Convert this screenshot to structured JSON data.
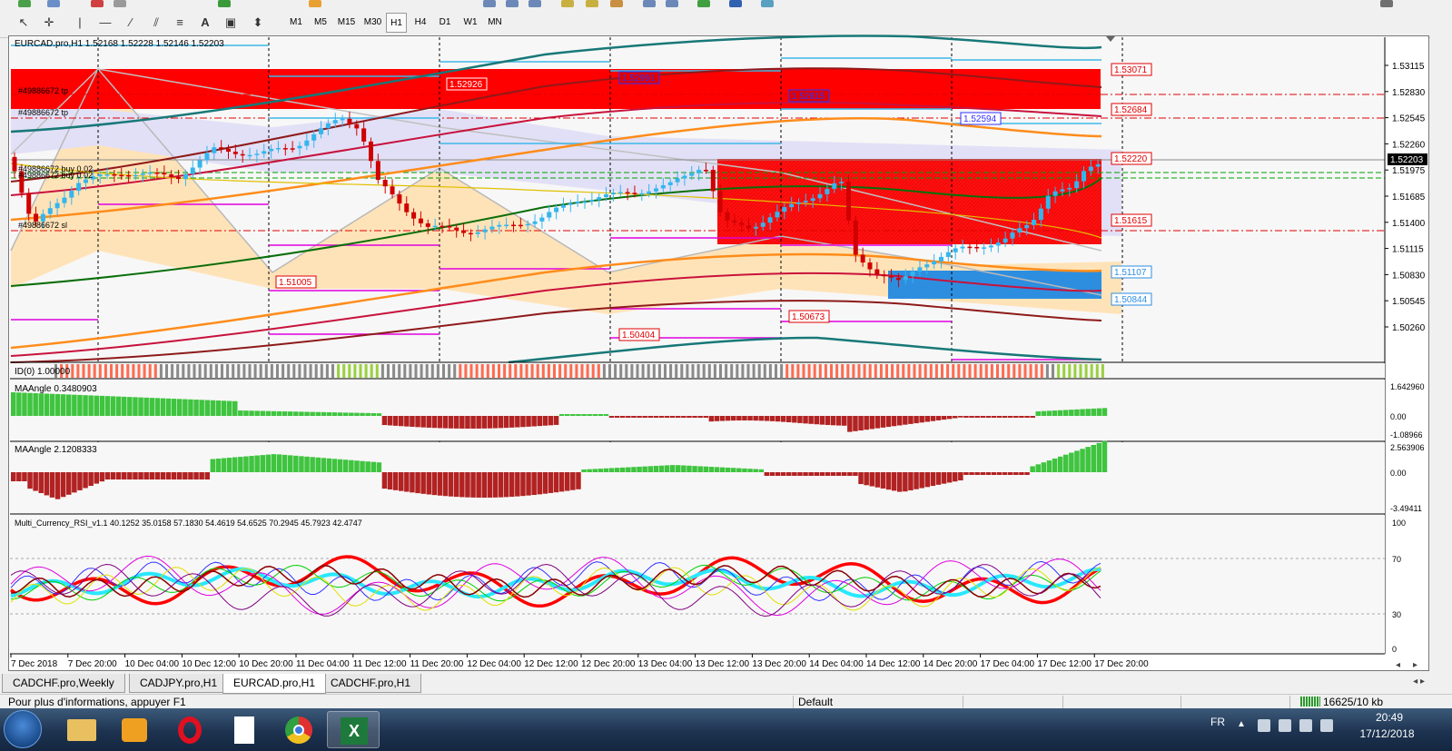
{
  "colors": {
    "bull_candle": "#33b6ee",
    "bear_candle": "#d00000",
    "ma_green": "#0a6e0a",
    "ma_teal": "#187878",
    "ma_orange": "#ff8c1a",
    "ma_crimson": "#c8123c",
    "ma_dark_red": "#8e1a1a",
    "zone_red": "#ff0000",
    "zone_lavender": "#e4e2f8",
    "zone_peach": "#ffe3b8",
    "zone_blue": "#2d8ee0",
    "hist_green": "#3fc43f",
    "hist_red": "#b22222",
    "rsi_red": "#ff0000",
    "rsi_cyan": "#28e8ff"
  },
  "toolbar": {
    "timeframes": [
      "M1",
      "M5",
      "M15",
      "M30",
      "H1",
      "H4",
      "D1",
      "W1",
      "MN"
    ],
    "active_timeframe": "H1"
  },
  "chart": {
    "header": "EURCAD.pro,H1  1.52168 1.52228 1.52146 1.52203",
    "price_axis": [
      "1.53115",
      "1.52830",
      "1.52545",
      "1.52260",
      "1.51975",
      "1.51685",
      "1.51400",
      "1.51115",
      "1.50830",
      "1.50545",
      "1.50260"
    ],
    "current_price": "1.52203",
    "price_tags_right": [
      "1.53071",
      "1.52684",
      "1.52220",
      "1.51615",
      "1.51107",
      "1.50844"
    ],
    "price_tags_chart": [
      "1.52926",
      "1.52991",
      "1.52815",
      "1.52594",
      "1.51005",
      "1.50673",
      "1.50404"
    ],
    "order_labels": [
      "#49886672 tp",
      "#49886672 tp",
      "#49886672 buy 0.02",
      "#49886672 buy 0.02",
      "#49886672 sl"
    ],
    "time_axis": [
      "7 Dec 2018",
      "7 Dec 20:00",
      "10 Dec 04:00",
      "10 Dec 12:00",
      "10 Dec 20:00",
      "11 Dec 04:00",
      "11 Dec 12:00",
      "11 Dec 20:00",
      "12 Dec 04:00",
      "12 Dec 12:00",
      "12 Dec 20:00",
      "13 Dec 04:00",
      "13 Dec 12:00",
      "13 Dec 20:00",
      "14 Dec 04:00",
      "14 Dec 12:00",
      "14 Dec 20:00",
      "17 Dec 04:00",
      "17 Dec 12:00",
      "17 Dec 20:00"
    ]
  },
  "indicators": {
    "id_label": "ID(0) 1.00000",
    "ma1_label": "MAAngle 0.3480903",
    "ma1_axis": [
      "1.642960",
      "0.00",
      "-1.08966"
    ],
    "ma2_label": "MAAngle 2.1208333",
    "ma2_axis": [
      "2.563906",
      "0.00",
      "-3.49411"
    ],
    "rsi_label": "Multi_Currency_RSI_v1.1 40.1252 35.0158 57.1830 54.4619 54.6525 70.2945 45.7923 42.4747",
    "rsi_axis": [
      "100",
      "70",
      "30",
      "0"
    ]
  },
  "tabs": [
    {
      "label": "CADCHF.pro,Weekly",
      "active": false
    },
    {
      "label": "CADJPY.pro,H1",
      "active": false
    },
    {
      "label": "EURCAD.pro,H1",
      "active": true
    },
    {
      "label": "CADCHF.pro,H1",
      "active": false
    }
  ],
  "status": {
    "help": "Pour plus d'informations, appuyer F1",
    "profile": "Default",
    "connection": "16625/10 kb"
  },
  "taskbar": {
    "language": "FR",
    "time": "20:49",
    "date": "17/12/2018",
    "apps": [
      "explorer-icon",
      "media-player-icon",
      "opera-icon",
      "document-icon",
      "chrome-icon",
      "excel-icon"
    ]
  }
}
